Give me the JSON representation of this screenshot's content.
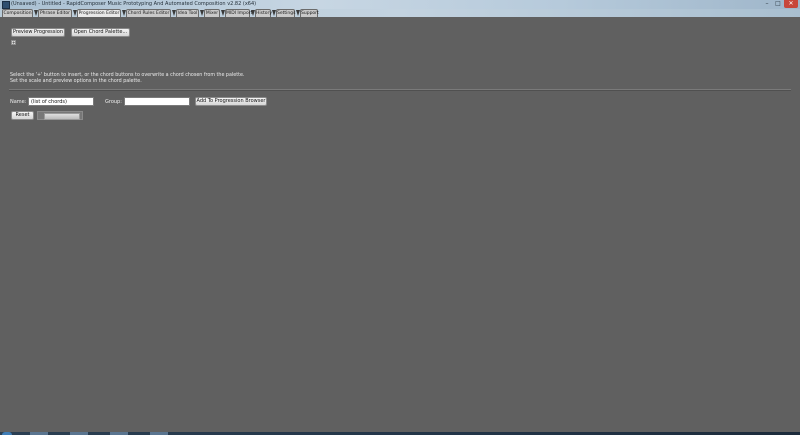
{
  "window": {
    "title": "(Unsaved) - Untitled - RapidComposer Music Prototyping And Automated Composition v2.82 (x64)",
    "minimize_glyph": "–",
    "maximize_glyph": "□",
    "close_glyph": "✕"
  },
  "tabs": [
    {
      "label": "Composition",
      "active": false
    },
    {
      "label": "Phrase Editor",
      "active": false
    },
    {
      "label": "Progression Editor",
      "active": true
    },
    {
      "label": "Chord Rules Editor",
      "active": false
    },
    {
      "label": "Idea Tool",
      "active": false
    },
    {
      "label": "Mixer",
      "active": false
    },
    {
      "label": "MIDI Import",
      "active": false
    },
    {
      "label": "History",
      "active": false
    },
    {
      "label": "Settings",
      "active": false
    },
    {
      "label": "Support",
      "active": false
    }
  ],
  "toolbar": {
    "preview_label": "Preview Progression",
    "open_palette_label": "Open Chord Palette...",
    "add_chord_glyph": "+"
  },
  "hints": {
    "line1": "Select the '+' button to insert, or the chord buttons to overwrite a chord chosen from the palette.",
    "line2": "Set the scale and preview options in the chord palette."
  },
  "form": {
    "name_label": "Name:",
    "name_value": "(list of chords)",
    "group_label": "Group:",
    "group_value": "",
    "add_label": "Add To Progression Browser",
    "reset_label": "Reset"
  },
  "colors": {
    "background": "#606060",
    "active_tab": "#e8e8e8",
    "close_button": "#c7463a"
  }
}
